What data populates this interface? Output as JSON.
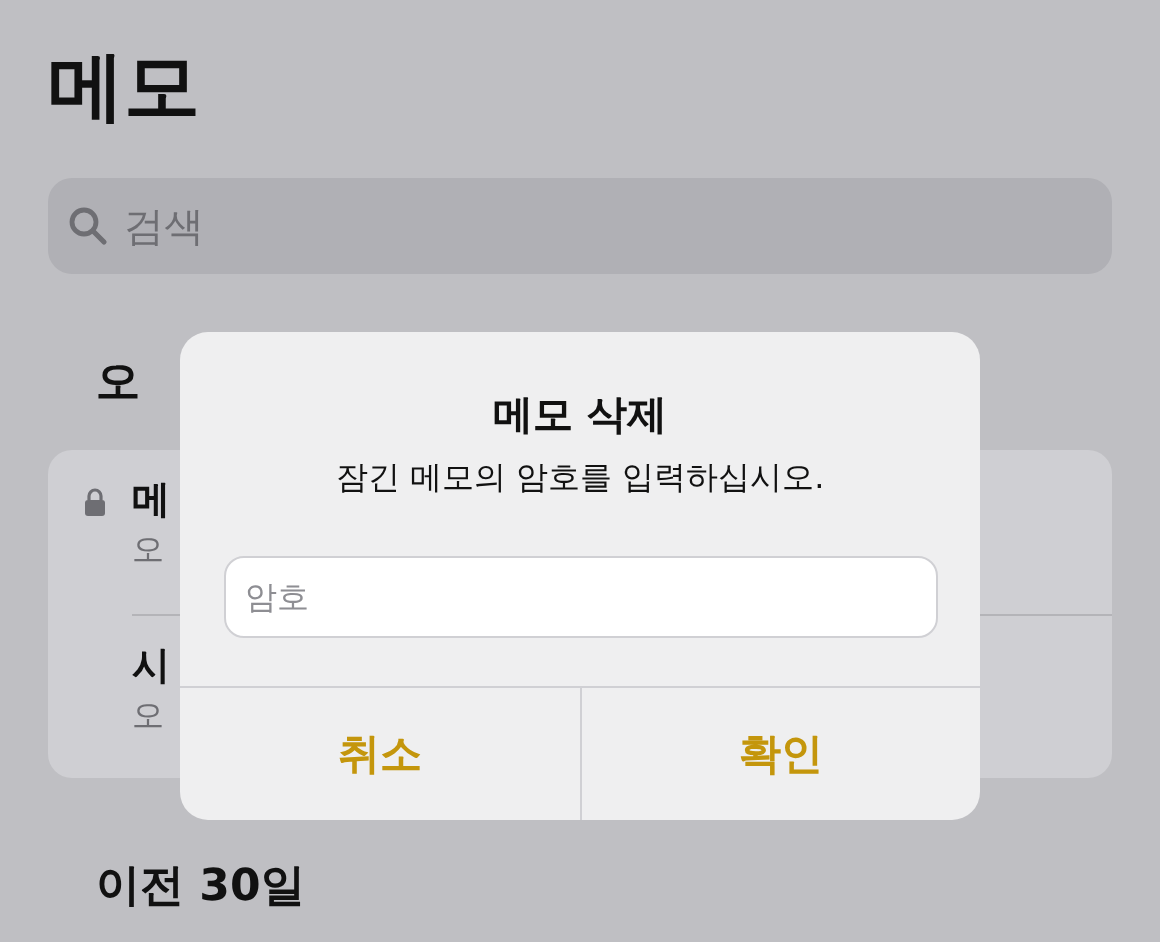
{
  "title": "메모",
  "search": {
    "placeholder": "검색"
  },
  "sections": [
    {
      "heading": "오",
      "notes": [
        {
          "title": "메",
          "subtitle": "오",
          "locked": true
        },
        {
          "title": "시",
          "subtitle": "오",
          "locked": false
        }
      ]
    },
    {
      "heading": "이전 30일"
    }
  ],
  "dialog": {
    "title": "메모 삭제",
    "message": "잠긴 메모의 암호를 입력하십시오.",
    "field": {
      "placeholder": "암호"
    },
    "buttons": [
      "취소",
      "확인"
    ]
  }
}
